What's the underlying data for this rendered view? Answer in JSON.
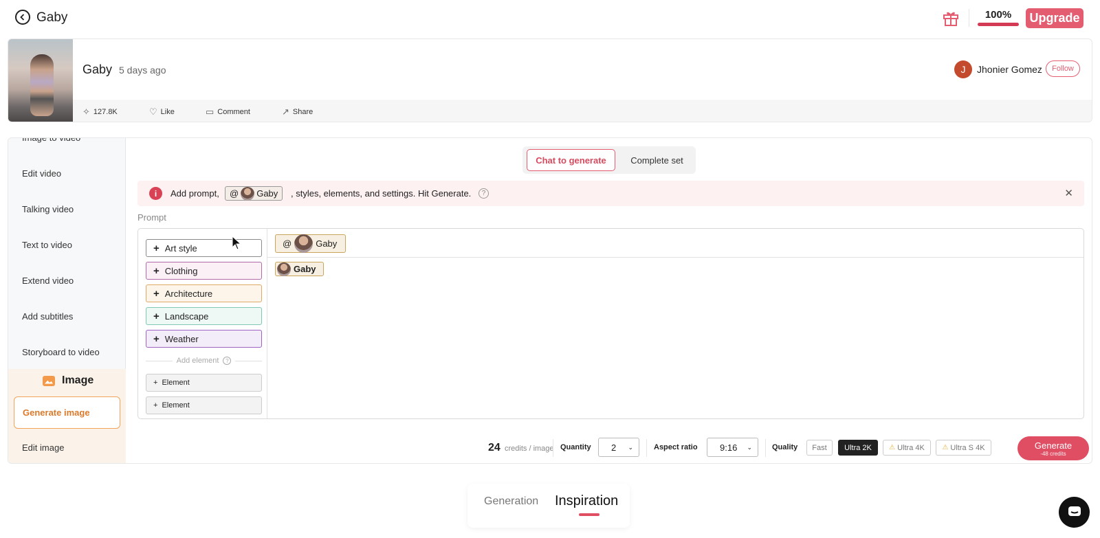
{
  "header": {
    "title": "Gaby",
    "percent": "100%",
    "upgrade_label": "Upgrade",
    "icons": [
      "back-arrow-icon",
      "gift-icon"
    ],
    "accent_color": "#e35c70"
  },
  "post": {
    "name": "Gaby",
    "time": "5 days ago",
    "author_initial": "J",
    "author_name": "Jhonier Gomez",
    "follow_label": "Follow",
    "actions": {
      "remix_count": "127.8K",
      "like": "Like",
      "comment": "Comment",
      "share": "Share"
    }
  },
  "sidebar": {
    "items": [
      "Image to video",
      "Edit video",
      "Talking video",
      "Text to video",
      "Extend video",
      "Add subtitles",
      "Storyboard to video"
    ],
    "image_section": {
      "title": "Image",
      "generate_label": "Generate image",
      "edit_label": "Edit image"
    }
  },
  "mode": {
    "chat_label": "Chat to generate",
    "set_label": "Complete set"
  },
  "hint": {
    "prefix": "Add prompt,",
    "at": "@",
    "mention": "Gaby",
    "suffix": ", styles, elements, and settings. Hit Generate."
  },
  "prompt": {
    "label": "Prompt",
    "styles": [
      {
        "label": "Art style",
        "color": "#8a8a8a",
        "bg": "#ffffff"
      },
      {
        "label": "Clothing",
        "color": "#b06aa8",
        "bg": "#faf0f6"
      },
      {
        "label": "Architecture",
        "color": "#e0a865",
        "bg": "#fdf5ea"
      },
      {
        "label": "Landscape",
        "color": "#7ec8b5",
        "bg": "#eef8f5"
      },
      {
        "label": "Weather",
        "color": "#9c63c2",
        "bg": "#f3ecf9"
      }
    ],
    "add_element_label": "Add element",
    "element_buttons": [
      "Element",
      "Element"
    ],
    "tag_at": "@",
    "tag_name": "Gaby",
    "body_tag": "Gaby"
  },
  "generate_bar": {
    "credits": "24",
    "credits_unit": "credits / image",
    "quantity_label": "Quantity",
    "quantity_value": "2",
    "aspect_label": "Aspect ratio",
    "aspect_value": "9:16",
    "quality_label": "Quality",
    "quality_options": [
      "Fast",
      "Ultra 2K",
      "Ultra 4K",
      "Ultra S 4K"
    ],
    "quality_selected": "Ultra 2K",
    "generate_label": "Generate",
    "generate_cost": "-48 credits"
  },
  "bottom_tabs": {
    "generation": "Generation",
    "inspiration": "Inspiration",
    "active": "Inspiration"
  }
}
